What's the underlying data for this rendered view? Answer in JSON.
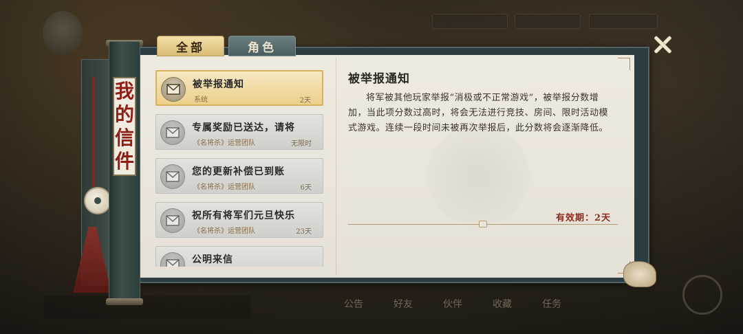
{
  "tabs": [
    {
      "label": "全部",
      "active": true
    },
    {
      "label": "角色",
      "active": false
    }
  ],
  "scroll_label": [
    "我",
    "的",
    "信",
    "件"
  ],
  "mails": [
    {
      "title": "被举报通知",
      "from": "系统",
      "expire": "2天",
      "active": true
    },
    {
      "title": "专属奖励已送达，请将",
      "from": "《名将杀》运营团队",
      "expire": "无限时",
      "active": false
    },
    {
      "title": "您的更新补偿已到账",
      "from": "《名将杀》运营团队",
      "expire": "6天",
      "active": false
    },
    {
      "title": "祝所有将军们元旦快乐",
      "from": "《名将杀》运营团队",
      "expire": "23天",
      "active": false
    },
    {
      "title": "公明来信",
      "from": "",
      "expire": "",
      "active": false
    }
  ],
  "detail": {
    "title": "被举报通知",
    "body": "将军被其他玩家举报“消极或不正常游戏”，被举报分数增加，当此项分数过高时，将会无法进行竞技、房间、限时活动模式游戏。连续一段时间未被再次举报后，此分数将会逐渐降低。",
    "validity": "有效期：2天"
  },
  "bottom_bar": [
    "公告",
    "好友",
    "伙伴",
    "收藏",
    "任务"
  ],
  "icons": {
    "close": "close-icon",
    "mail": "envelope-icon"
  },
  "colors": {
    "accent_red": "#8e1e16",
    "active_item": "#eccf8a",
    "frame": "#2b3d40"
  }
}
